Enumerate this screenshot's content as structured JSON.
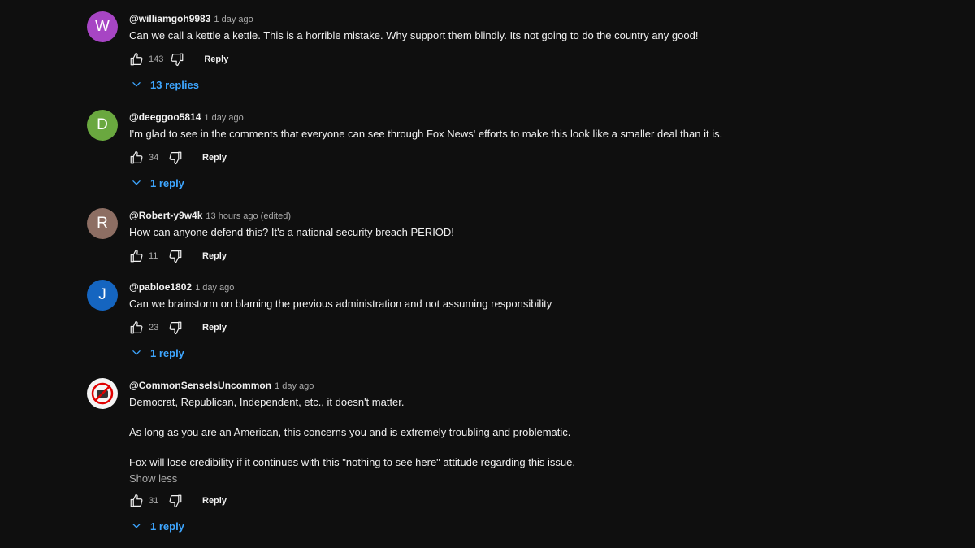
{
  "colors": {
    "background": "#0f0f0f",
    "text": "#f1f1f1",
    "secondary_text": "#aaaaaa",
    "link_blue": "#3ea6ff"
  },
  "comments": [
    {
      "avatar_letter": "W",
      "avatar_color": "#a745c4",
      "handle": "@williamgoh9983",
      "time": "1 day ago",
      "paragraphs": [
        "Can we call a kettle a kettle. This is a horrible mistake. Why support them blindly. Its not going to do the country any good!"
      ],
      "likes": "143",
      "reply_label": "Reply",
      "replies_label": "13 replies"
    },
    {
      "avatar_letter": "D",
      "avatar_color": "#6aa83f",
      "handle": "@deeggoo5814",
      "time": "1 day ago",
      "paragraphs": [
        "I'm glad to see in the comments that everyone can see through Fox News' efforts to make this look like a smaller deal than it is."
      ],
      "likes": "34",
      "reply_label": "Reply",
      "replies_label": "1 reply"
    },
    {
      "avatar_letter": "R",
      "avatar_color": "#8d6e63",
      "handle": "@Robert-y9w4k",
      "time": "13 hours ago (edited)",
      "paragraphs": [
        "How can anyone defend this? It's a national security breach    PERIOD!"
      ],
      "likes": "11",
      "reply_label": "Reply",
      "replies_label": ""
    },
    {
      "avatar_letter": "J",
      "avatar_color": "#1565c0",
      "handle": "@pabloe1802",
      "time": "1 day ago",
      "paragraphs": [
        "Can we brainstorm on blaming the previous administration and not assuming responsibility"
      ],
      "likes": "23",
      "reply_label": "Reply",
      "replies_label": "1 reply"
    },
    {
      "avatar_letter": "",
      "avatar_color": "#f4f4f4",
      "avatar_icon": "no-symbol-avatar",
      "handle": "@CommonSenseIsUncommon",
      "time": "1 day ago",
      "paragraphs": [
        "Democrat, Republican, Independent, etc., it doesn't matter.",
        "As long as you are an American, this concerns you and is extremely troubling and problematic.",
        "Fox will lose credibility if it continues with this \"nothing to see here\" attitude regarding this issue."
      ],
      "show_less_label": "Show less",
      "likes": "31",
      "reply_label": "Reply",
      "replies_label": "1 reply"
    }
  ]
}
